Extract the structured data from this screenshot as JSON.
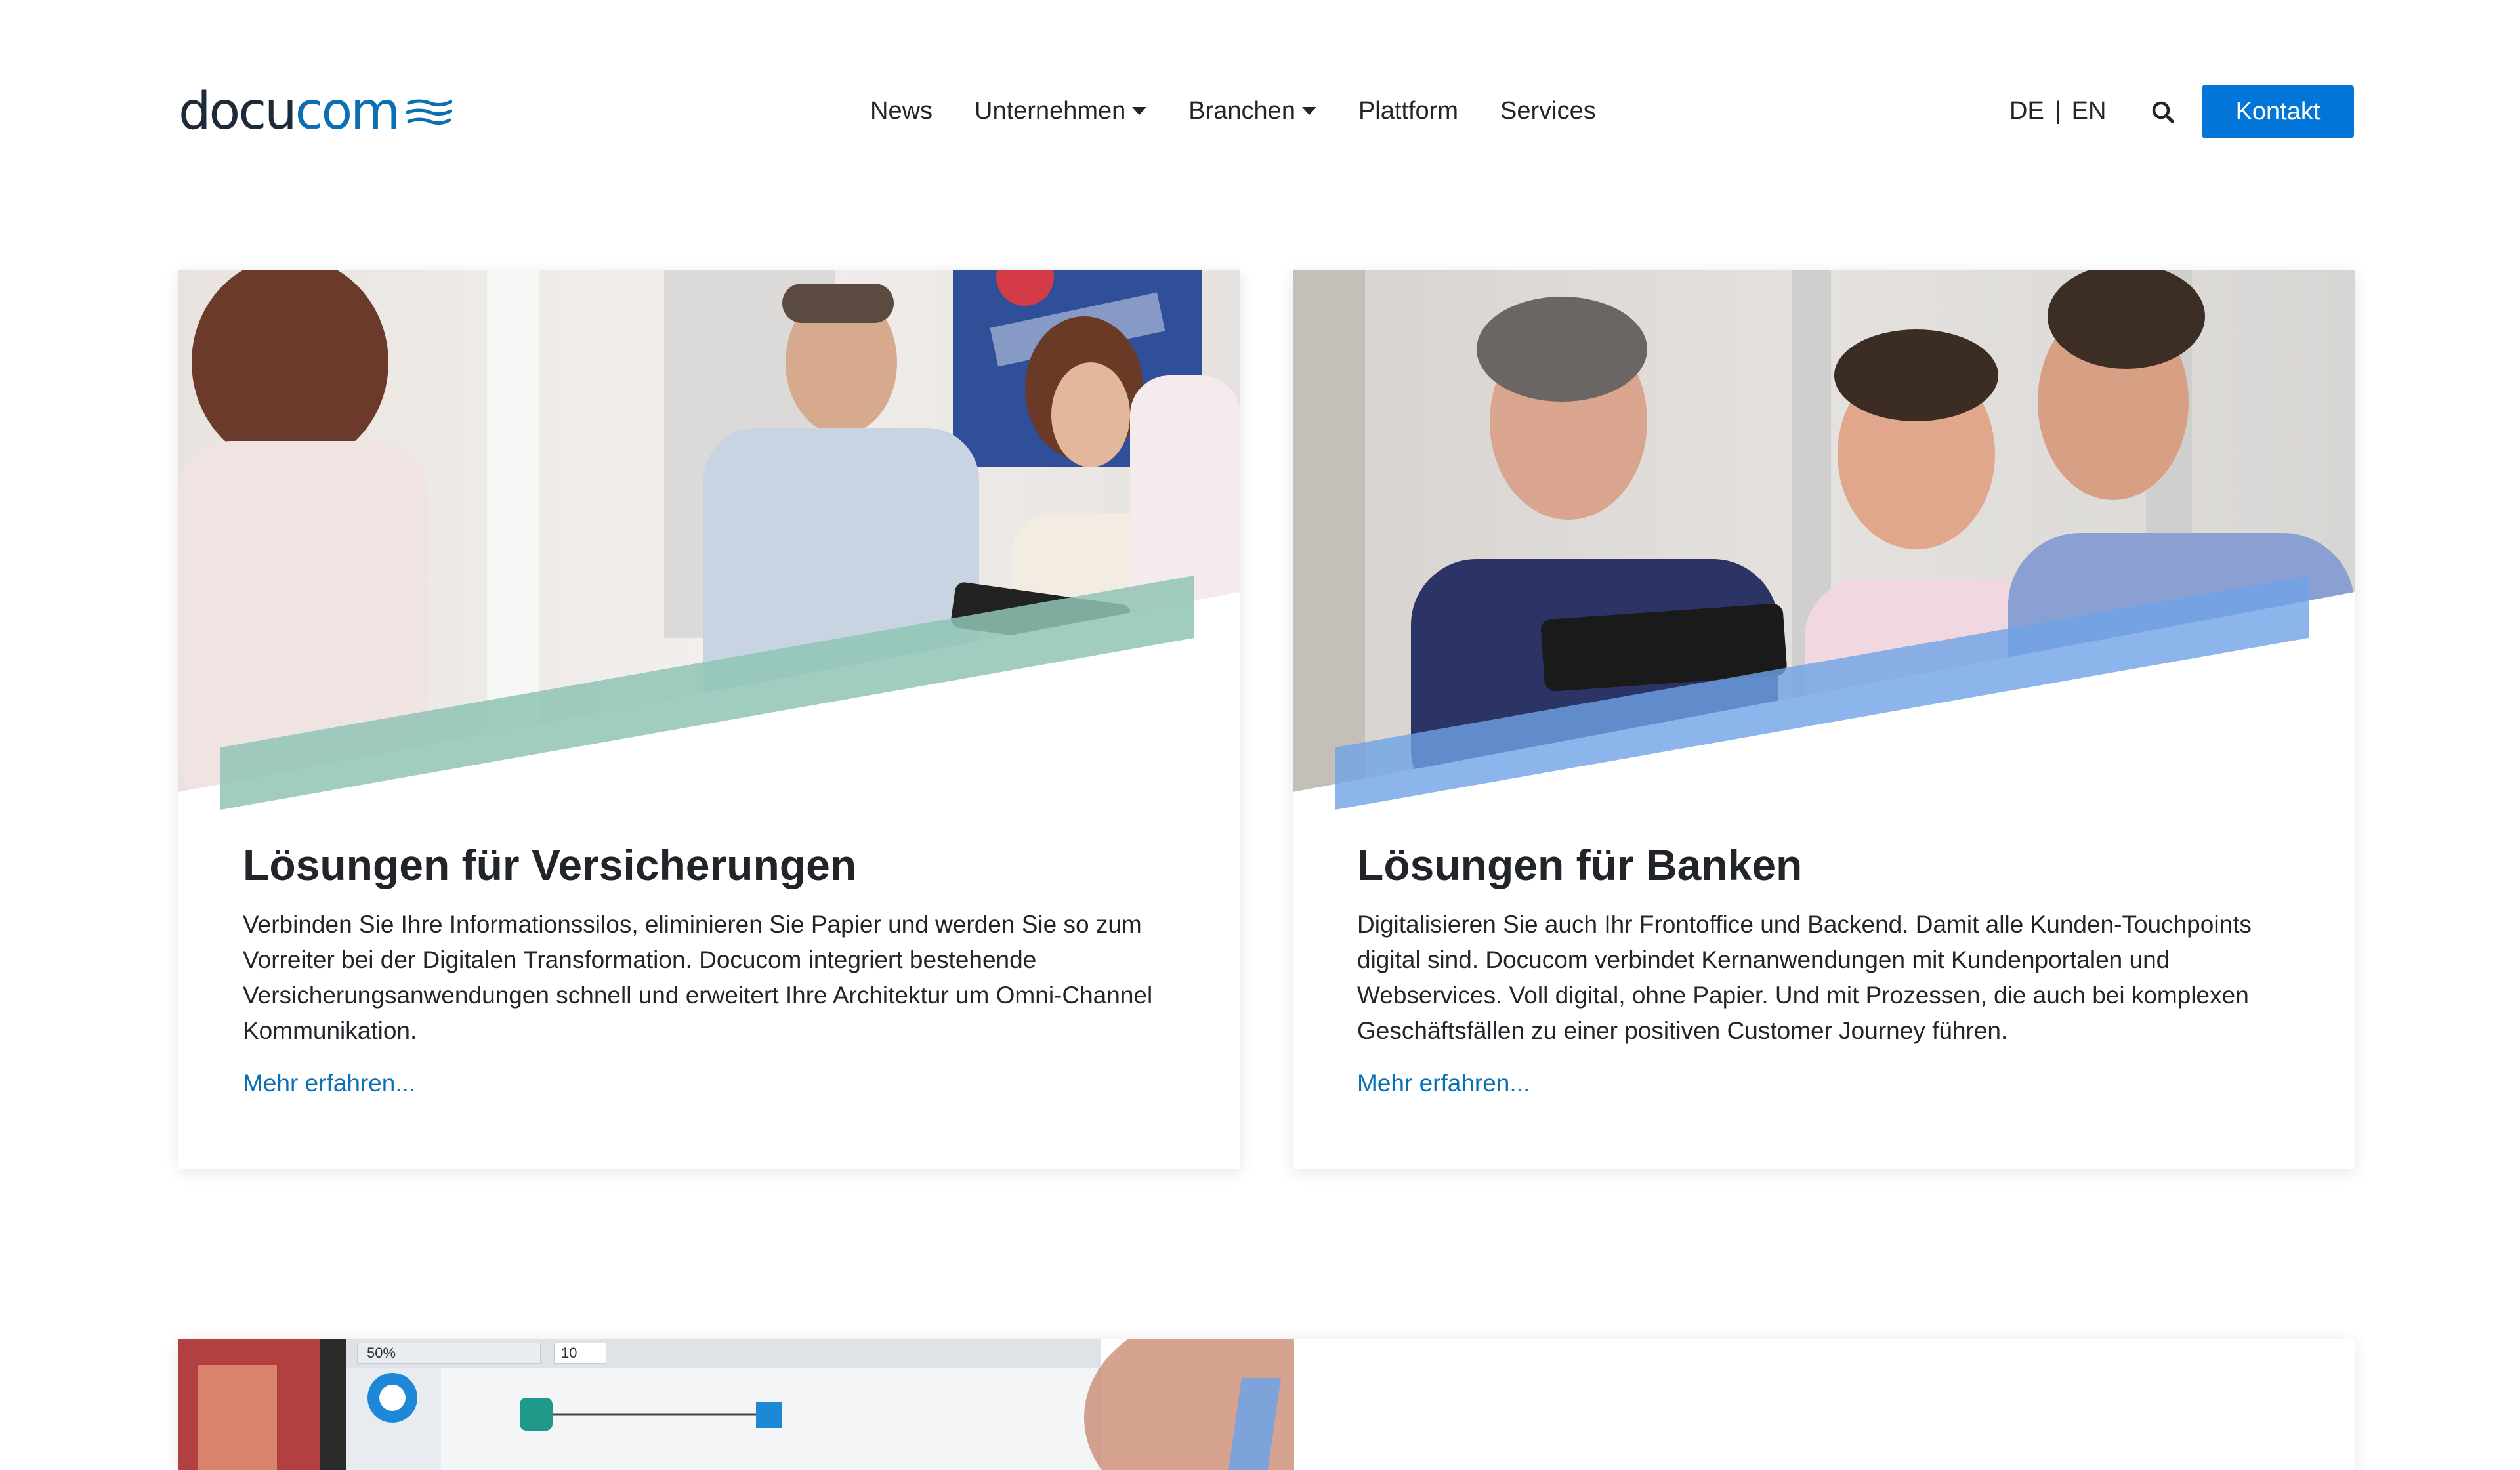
{
  "header": {
    "logo": {
      "text_main": "docu",
      "text_accent": "com"
    },
    "nav": [
      {
        "label": "News",
        "dropdown": false
      },
      {
        "label": "Unternehmen",
        "dropdown": true
      },
      {
        "label": "Branchen",
        "dropdown": true
      },
      {
        "label": "Plattform",
        "dropdown": false
      },
      {
        "label": "Services",
        "dropdown": false
      }
    ],
    "lang": {
      "de": "DE",
      "separator": "|",
      "en": "EN"
    },
    "search_icon": "search-icon",
    "contact_label": "Kontakt"
  },
  "cards": [
    {
      "title": "Lösungen für Versicherungen",
      "description": "Verbinden Sie Ihre Informationssilos, eliminieren Sie Papier und werden Sie so zum Vorreiter bei der Digitalen Transformation. Docucom integriert bestehende Versicherungsanwendungen schnell und erweitert Ihre Architektur um Omni-Channel Kommunikation.",
      "link": "Mehr erfahren...",
      "accent_color": "#8fc4b5"
    },
    {
      "title": "Lösungen für Banken",
      "description": "Digitalisieren Sie auch Ihr Frontoffice und Backend. Damit alle Kunden-Touchpoints digital sind. Docucom verbindet Kernanwendungen mit Kundenportalen und Webservices. Voll digital, ohne Papier. Und mit Prozessen, die auch bei komplexen Geschäftsfällen zu einer positiven Customer Journey führen.",
      "link": "Mehr erfahren...",
      "accent_color": "#6fa3e6"
    }
  ],
  "bottom_card": {
    "zoom_value": "50%",
    "stepper_value": "10"
  },
  "colors": {
    "brand_blue": "#0275d8",
    "link_blue": "#0b6fb3",
    "text": "#212529"
  }
}
